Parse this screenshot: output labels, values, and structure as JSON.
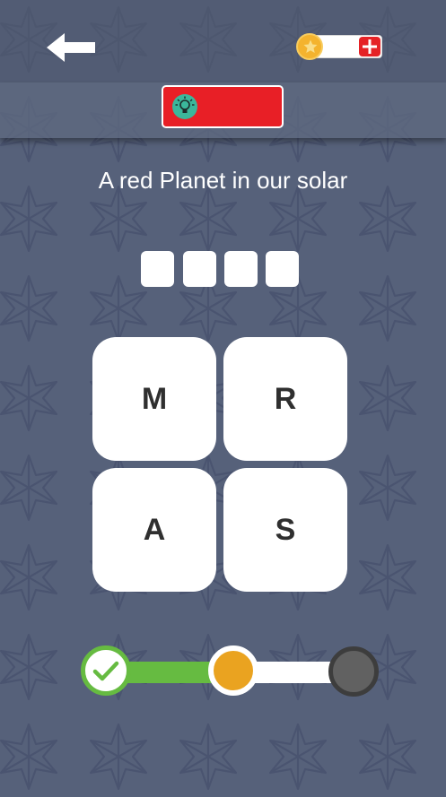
{
  "header": {
    "back_icon": "arrow-left-icon",
    "coin_icon": "star-coin-icon",
    "add_coins_icon": "plus-icon",
    "coin_count": ""
  },
  "hint": {
    "button_icon": "lightbulb-icon",
    "label": ""
  },
  "puzzle": {
    "question": "A red Planet in our solar",
    "answer_slots": [
      "",
      "",
      "",
      ""
    ],
    "letters": [
      "M",
      "R",
      "A",
      "S"
    ]
  },
  "progress": {
    "stages": [
      "completed",
      "current",
      "locked"
    ],
    "icons": [
      "checkmark-icon",
      "current-stage-dot",
      "locked-stage-dot"
    ]
  },
  "colors": {
    "background": "#56617a",
    "hint_button": "#e81f26",
    "add_button": "#e52226",
    "coin": "#f4b32e",
    "progress_done": "#66bb41",
    "progress_current": "#eaa320",
    "progress_locked": "#616161",
    "bulb_circle": "#3bb79b"
  }
}
